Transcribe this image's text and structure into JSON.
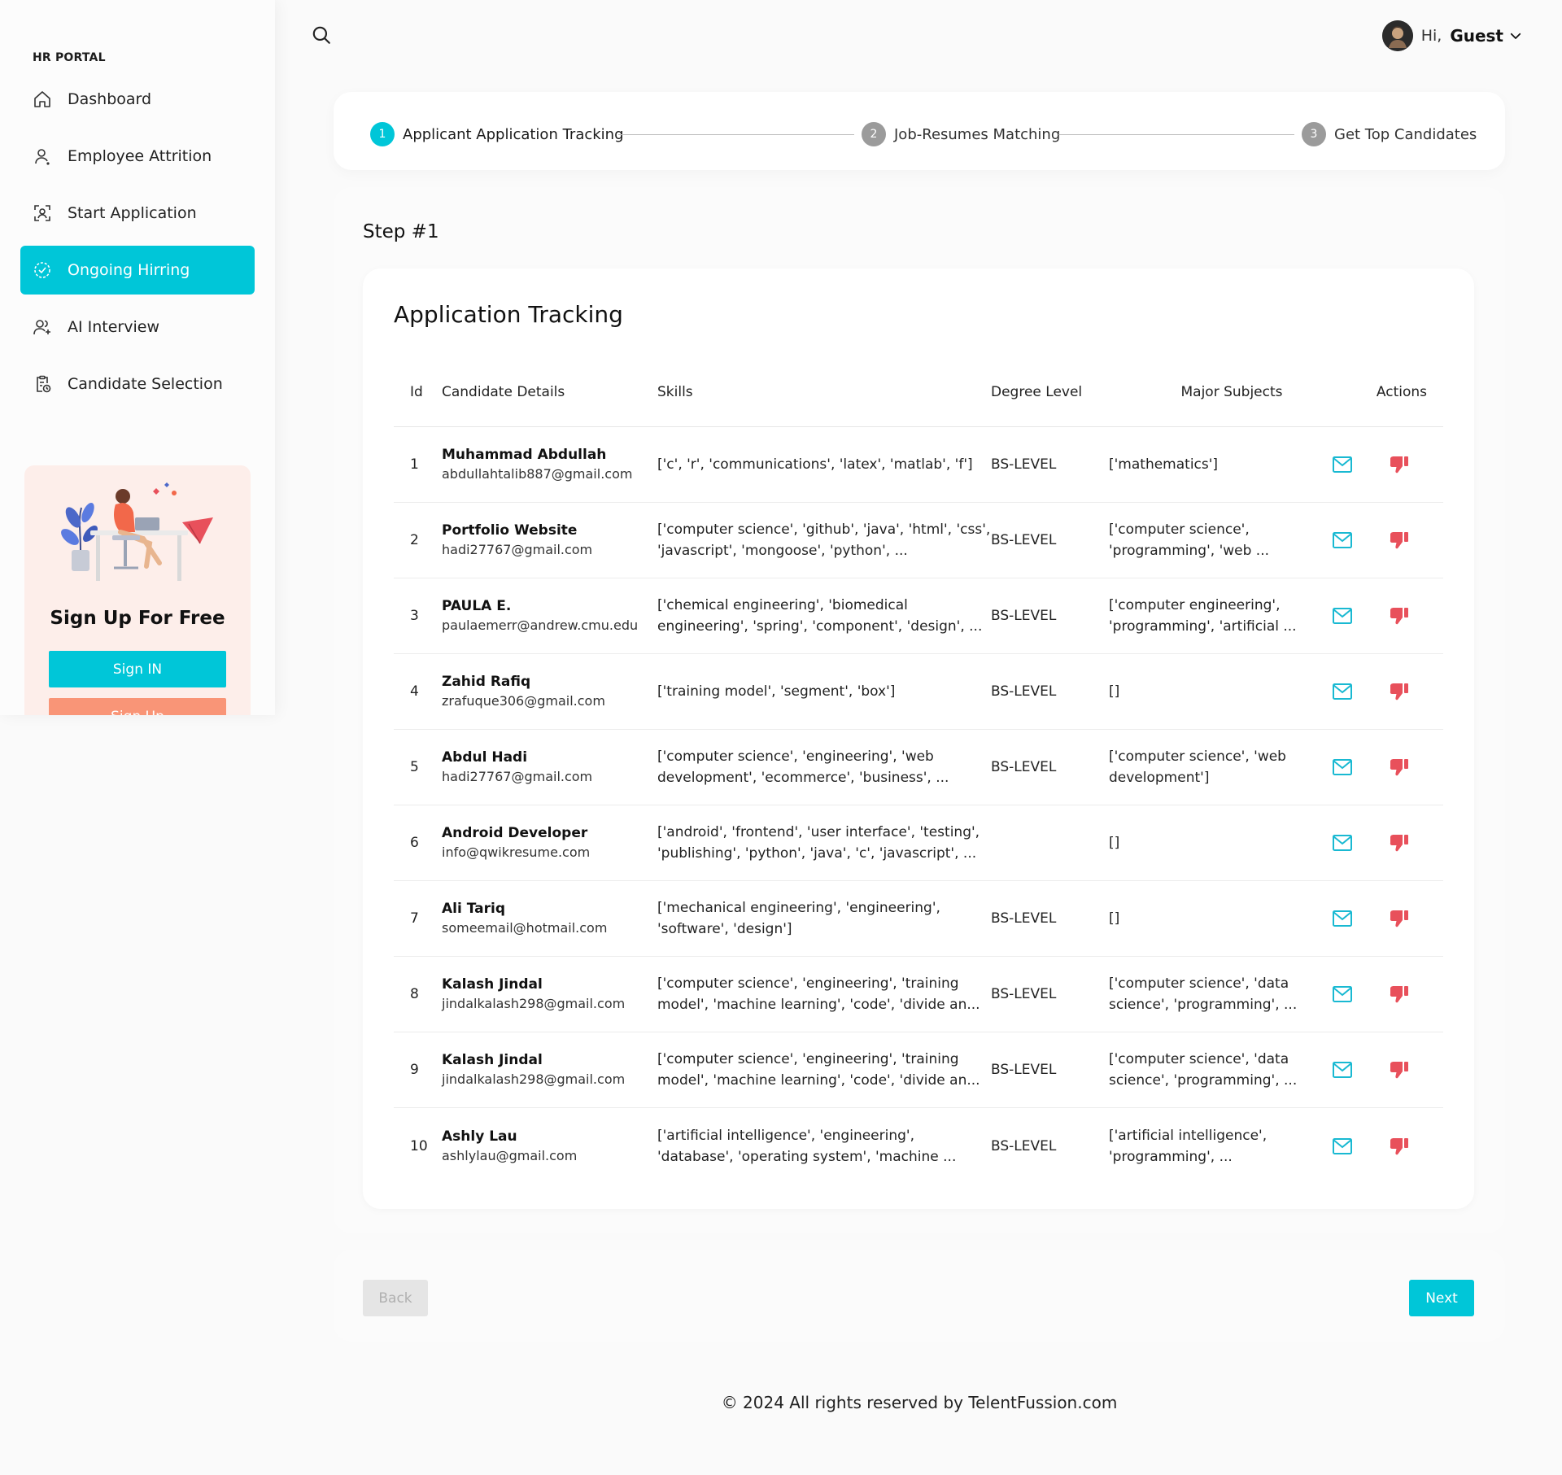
{
  "sidebar": {
    "brand": "HR PORTAL",
    "items": [
      {
        "label": "Dashboard",
        "icon": "home-icon"
      },
      {
        "label": "Employee Attrition",
        "icon": "user-icon"
      },
      {
        "label": "Start Application",
        "icon": "face-scan-icon"
      },
      {
        "label": "Ongoing Hirring",
        "icon": "check-circle-icon",
        "active": true
      },
      {
        "label": "AI Interview",
        "icon": "users-plus-icon"
      },
      {
        "label": "Candidate Selection",
        "icon": "clipboard-clock-icon"
      }
    ],
    "promo": {
      "title": "Sign Up For Free",
      "signin_label": "Sign IN",
      "signup_label": "Sign Up"
    }
  },
  "header": {
    "greeting": "Hi,",
    "username": "Guest"
  },
  "stepper": {
    "steps": [
      {
        "number": "1",
        "label": "Applicant Application Tracking",
        "active": true
      },
      {
        "number": "2",
        "label": "Job-Resumes Matching",
        "active": false
      },
      {
        "number": "3",
        "label": "Get Top Candidates",
        "active": false
      }
    ]
  },
  "main": {
    "step_title": "Step #1",
    "table_title": "Application Tracking",
    "columns": [
      "Id",
      "Candidate Details",
      "Skills",
      "Degree Level",
      "Major Subjects",
      "Actions"
    ],
    "rows": [
      {
        "id": "1",
        "name": "Muhammad Abdullah",
        "email": "abdullahtalib887@gmail.com",
        "skills": "['c', 'r', 'communications', 'latex', 'matlab', 'f']",
        "degree": "BS-LEVEL",
        "major": "['mathematics']"
      },
      {
        "id": "2",
        "name": "Portfolio Website",
        "email": "hadi27767@gmail.com",
        "skills": "['computer science', 'github', 'java', 'html', 'css', 'javascript', 'mongoose', 'python', ...",
        "degree": "BS-LEVEL",
        "major": "['computer science', 'programming', 'web ..."
      },
      {
        "id": "3",
        "name": "PAULA E.",
        "email": "paulaemerr@andrew.cmu.edu",
        "skills": "['chemical engineering', 'biomedical engineering', 'spring', 'component', 'design', ...",
        "degree": "BS-LEVEL",
        "major": "['computer engineering', 'programming', 'artificial ..."
      },
      {
        "id": "4",
        "name": "Zahid Rafiq",
        "email": "zrafuque306@gmail.com",
        "skills": "['training model', 'segment', 'box']",
        "degree": "BS-LEVEL",
        "major": "[]"
      },
      {
        "id": "5",
        "name": "Abdul Hadi",
        "email": "hadi27767@gmail.com",
        "skills": "['computer science', 'engineering', 'web development', 'ecommerce', 'business', ...",
        "degree": "BS-LEVEL",
        "major": "['computer science', 'web development']"
      },
      {
        "id": "6",
        "name": "Android Developer",
        "email": "info@qwikresume.com",
        "skills": "['android', 'frontend', 'user interface', 'testing', 'publishing', 'python', 'java', 'c', 'javascript', ...",
        "degree": "",
        "major": "[]"
      },
      {
        "id": "7",
        "name": "Ali Tariq",
        "email": "someemail@hotmail.com",
        "skills": "['mechanical engineering', 'engineering', 'software', 'design']",
        "degree": "BS-LEVEL",
        "major": "[]"
      },
      {
        "id": "8",
        "name": "Kalash Jindal",
        "email": "jindalkalash298@gmail.com",
        "skills": "['computer science', 'engineering', 'training model', 'machine learning', 'code', 'divide an...",
        "degree": "BS-LEVEL",
        "major": "['computer science', 'data science', 'programming', ..."
      },
      {
        "id": "9",
        "name": "Kalash Jindal",
        "email": "jindalkalash298@gmail.com",
        "skills": "['computer science', 'engineering', 'training model', 'machine learning', 'code', 'divide an...",
        "degree": "BS-LEVEL",
        "major": "['computer science', 'data science', 'programming', ..."
      },
      {
        "id": "10",
        "name": "Ashly Lau",
        "email": "ashlylau@gmail.com",
        "skills": "['artificial intelligence', 'engineering', 'database', 'operating system', 'machine ...",
        "degree": "BS-LEVEL",
        "major": "['artificial intelligence', 'programming', ..."
      }
    ]
  },
  "footer_nav": {
    "back_label": "Back",
    "next_label": "Next"
  },
  "copyright": "© 2024 All rights reserved by TelentFussion.com",
  "colors": {
    "accent": "#00c6d8",
    "signup": "#f99577",
    "dislike": "#e8505b",
    "background": "#fafafa"
  }
}
